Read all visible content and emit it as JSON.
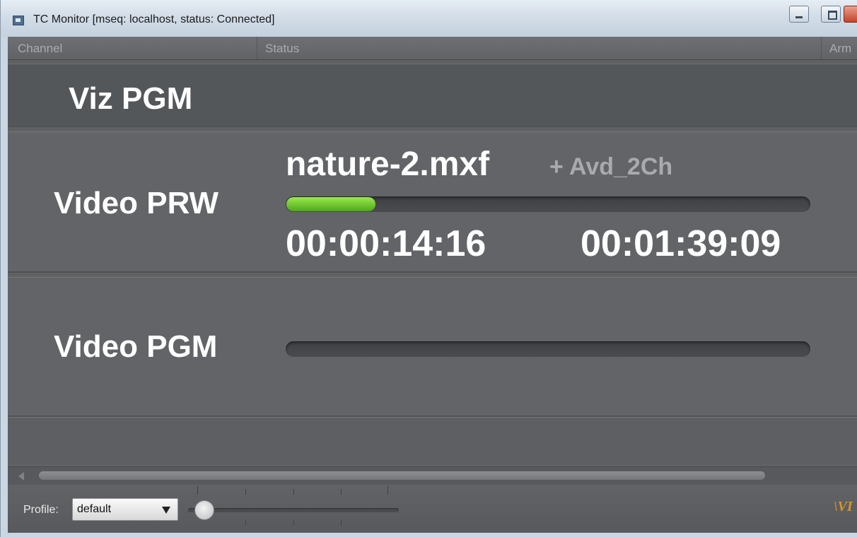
{
  "window": {
    "title": "TC Monitor [mseq: localhost, status: Connected]"
  },
  "table": {
    "columns": [
      "Channel",
      "Status",
      "Arm"
    ],
    "rows": [
      {
        "channel": "Viz PGM"
      },
      {
        "channel": "Video PRW",
        "filename": "nature-2.mxf",
        "extra": "+ Avd_2Ch",
        "progress": 0.17,
        "elapsed": "00:00:14:16",
        "duration": "00:01:39:09"
      },
      {
        "channel": "Video PGM",
        "progress": 0
      }
    ]
  },
  "bottom": {
    "profile_label": "Profile:",
    "profile_value": "default",
    "logo": "\\VI"
  },
  "colors": {
    "progress": "#5cb825",
    "background": "#5f6163"
  }
}
